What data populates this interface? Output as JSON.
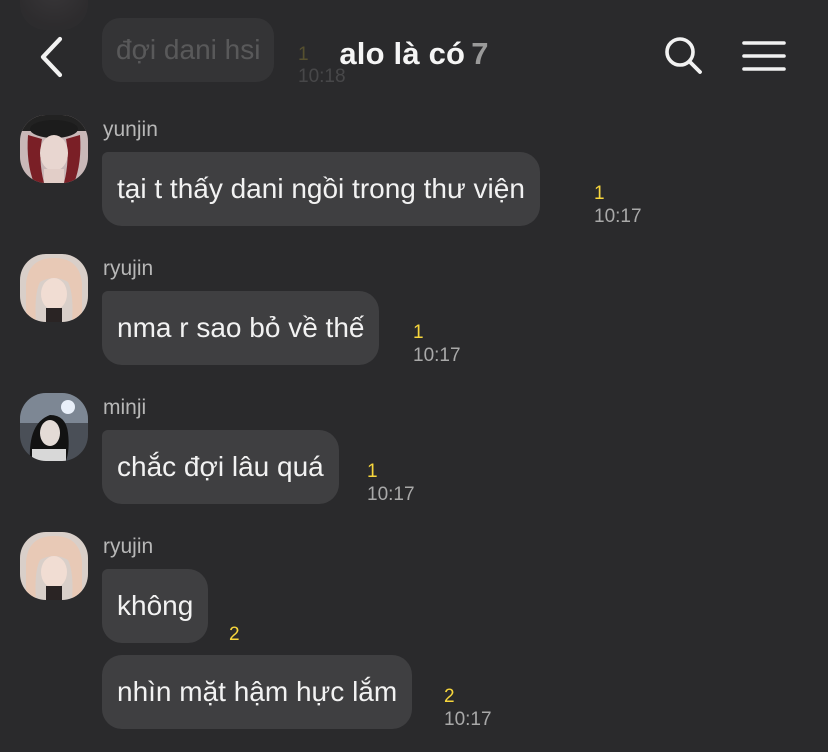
{
  "header": {
    "title": "alo là có",
    "member_count": "7"
  },
  "faded_message": {
    "text": "đợi dani hsi",
    "unread": "1",
    "time": "10:18"
  },
  "messages": [
    {
      "sender": "yunjin",
      "avatar": "avatar-yunjin",
      "text": "tại t thấy dani ngồi trong thư viện",
      "unread": "1",
      "time": "10:17"
    },
    {
      "sender": "ryujin",
      "avatar": "avatar-ryujin",
      "text": "nma r sao bỏ về thế",
      "unread": "1",
      "time": "10:17"
    },
    {
      "sender": "minji",
      "avatar": "avatar-minji",
      "text": "chắc đợi lâu quá",
      "unread": "1",
      "time": "10:17"
    },
    {
      "sender": "ryujin",
      "avatar": "avatar-ryujin",
      "text": "không",
      "unread": "2",
      "time": ""
    },
    {
      "sender": "",
      "avatar": "",
      "text": "nhìn mặt hậm hực lắm",
      "unread": "2",
      "time": "10:17"
    }
  ],
  "colors": {
    "background": "#2a2a2c",
    "bubble": "#3f3f41",
    "unread_count": "#f7d63c",
    "timestamp": "#a9a9a9",
    "sender_name": "#b7b7b7"
  },
  "icons": [
    "back-arrow-icon",
    "search-icon",
    "menu-icon"
  ]
}
